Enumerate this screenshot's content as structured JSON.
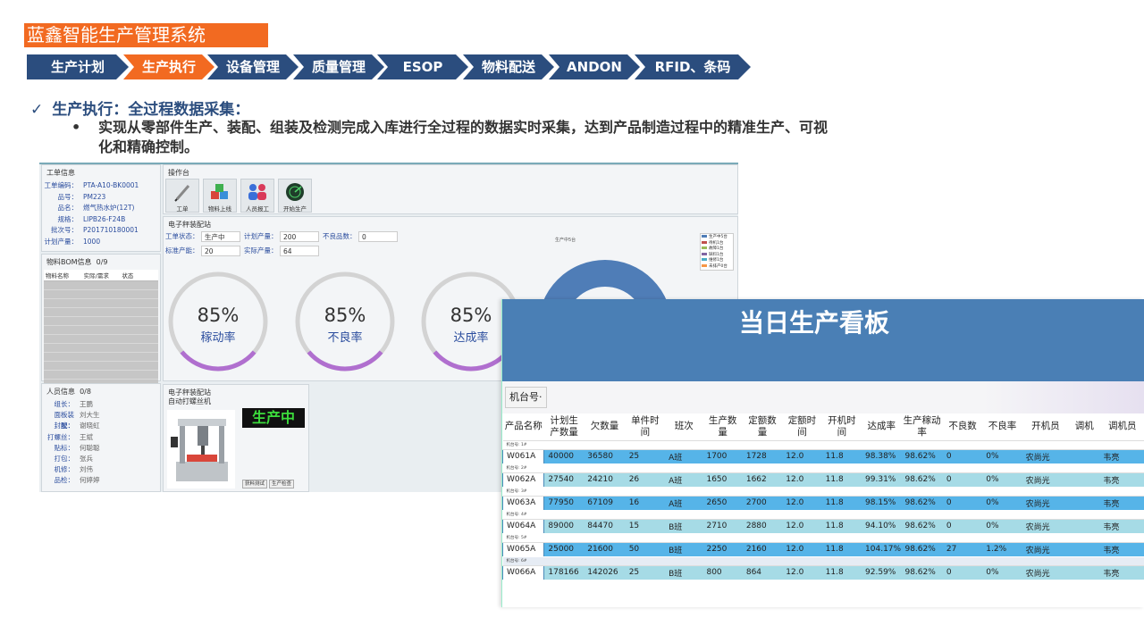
{
  "slide": {
    "title": "蓝鑫智能生产管理系统",
    "nav": [
      "生产计划",
      "生产执行",
      "设备管理",
      "质量管理",
      "ESOP",
      "物料配送",
      "ANDON",
      "RFID、条码"
    ],
    "active_nav": "生产执行",
    "heading": "生产执行：全过程数据采集：",
    "bullet": "实现从零部件生产、装配、组装及检测完成入库进行全过程的数据实时采集，达到产品制造过程中的精准生产、可视化和精确控制。"
  },
  "mes": {
    "work_order": {
      "title": "工单信息",
      "fields": [
        {
          "k": "工单编码：",
          "v": "PTA-A10-BK0001"
        },
        {
          "k": "品号：",
          "v": "PM223"
        },
        {
          "k": "品名：",
          "v": "燃气热水炉(12T)"
        },
        {
          "k": "规格：",
          "v": "LIPB26-F24B"
        },
        {
          "k": "批次号：",
          "v": "P201710180001"
        },
        {
          "k": "计划产量：",
          "v": "1000"
        }
      ]
    },
    "bom": {
      "title": "物料BOM信息",
      "count": "0/9",
      "columns": [
        "物料名称",
        "实际/需求",
        "状态"
      ]
    },
    "staff": {
      "title": "人员信息",
      "count": "0/8",
      "rows": [
        {
          "k": "组长：",
          "v": "王鹏"
        },
        {
          "k": "面板装配：",
          "v": "刘大生"
        },
        {
          "k": "封胶：",
          "v": "谢晓虹"
        },
        {
          "k": "打螺丝：",
          "v": "王斌"
        },
        {
          "k": "贴标：",
          "v": "何聪聪"
        },
        {
          "k": "打包：",
          "v": "张兵"
        },
        {
          "k": "机修：",
          "v": "刘伟"
        },
        {
          "k": "品检：",
          "v": "何婷婷"
        }
      ]
    },
    "ops": {
      "title": "操作台",
      "buttons": [
        {
          "label": "工单",
          "icon": "pen-icon"
        },
        {
          "label": "物料上线",
          "icon": "cubes-icon"
        },
        {
          "label": "人员报工",
          "icon": "people-icon"
        },
        {
          "label": "开始生产",
          "icon": "radar-icon"
        }
      ]
    },
    "station": {
      "title": "电子秤装配站",
      "status_label": "工单状态：",
      "status_value": "生产中",
      "plan_label": "计划产量：",
      "plan_value": "200",
      "defect_label": "不良品数：",
      "defect_value": "0",
      "std_label": "标准产能：",
      "std_value": "20",
      "actual_label": "实际产量：",
      "actual_value": "64",
      "gauges": [
        {
          "value": "85%",
          "label": "稼动率",
          "fraction": 0.85
        },
        {
          "value": "85%",
          "label": "不良率",
          "fraction": 0.85
        },
        {
          "value": "85%",
          "label": "达成率",
          "fraction": 0.85
        }
      ],
      "donut_title": "生产中5台",
      "legend": [
        "生产中5台",
        "待机1台",
        "故障1台",
        "缺料1台",
        "维修1台",
        "未排产0台"
      ],
      "legend_colors": [
        "#4f7db7",
        "#c0504d",
        "#9bbb59",
        "#8064a2",
        "#4bacc6",
        "#f79646"
      ]
    },
    "robot": {
      "title": "电子秤装配站",
      "subtitle": "自动打螺丝机",
      "status": "生产中",
      "btn1": "获料测试",
      "btn2": "生产检查"
    }
  },
  "board": {
    "title": "当日生产看板",
    "filter_label": "机台号·",
    "columns": [
      "产品名称",
      "计划生产数量",
      "欠数量",
      "单件时间",
      "班次",
      "生产数量",
      "定额数量",
      "定额时间",
      "开机时间",
      "达成率",
      "生产稼动率",
      "不良数",
      "不良率",
      "开机员",
      "调机",
      "调机员"
    ],
    "groups": [
      {
        "label": "机台号: 1#",
        "row": [
          "W061A",
          "40000",
          "36580",
          "25",
          "A班",
          "1700",
          "1728",
          "12.0",
          "11.8",
          "98.38%",
          "98.62%",
          "0",
          "0%",
          "农尚光",
          "",
          "韦亮"
        ],
        "blue": true
      },
      {
        "label": "机台号: 2#",
        "row": [
          "W062A",
          "27540",
          "24210",
          "26",
          "A班",
          "1650",
          "1662",
          "12.0",
          "11.8",
          "99.31%",
          "98.62%",
          "0",
          "0%",
          "农尚光",
          "",
          "韦亮"
        ],
        "blue": false
      },
      {
        "label": "机台号: 3#",
        "row": [
          "W063A",
          "77950",
          "67109",
          "16",
          "A班",
          "2650",
          "2700",
          "12.0",
          "11.8",
          "98.15%",
          "98.62%",
          "0",
          "0%",
          "农尚光",
          "",
          "韦亮"
        ],
        "blue": true
      },
      {
        "label": "机台号: 4#",
        "row": [
          "W064A",
          "89000",
          "84470",
          "15",
          "B班",
          "2710",
          "2880",
          "12.0",
          "11.8",
          "94.10%",
          "98.62%",
          "0",
          "0%",
          "农尚光",
          "",
          "韦亮"
        ],
        "blue": false
      },
      {
        "label": "机台号: 5#",
        "row": [
          "W065A",
          "25000",
          "21600",
          "50",
          "B班",
          "2250",
          "2160",
          "12.0",
          "11.8",
          "104.17%",
          "98.62%",
          "27",
          "1.2%",
          "农尚光",
          "",
          "韦亮"
        ],
        "blue": true
      },
      {
        "label": "机台号: 6#",
        "row": [
          "W066A",
          "178166",
          "142026",
          "25",
          "B班",
          "800",
          "864",
          "12.0",
          "11.8",
          "92.59%",
          "98.62%",
          "0",
          "0%",
          "农尚光",
          "",
          "韦亮"
        ],
        "blue": false
      }
    ]
  }
}
